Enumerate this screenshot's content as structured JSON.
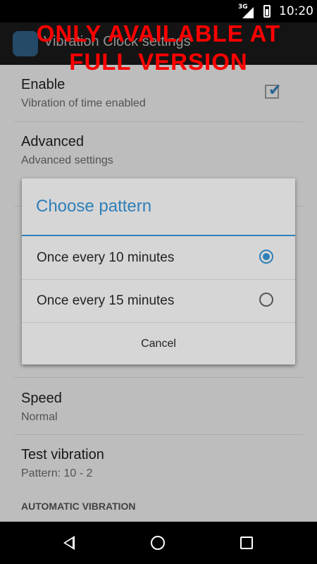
{
  "status_bar": {
    "network": "3G",
    "time": "10:20"
  },
  "action_bar": {
    "title": "Vibration Clock settings"
  },
  "promo_banner": {
    "line1": "ONLY AVAILABLE AT",
    "line2": "FULL VERSION"
  },
  "settings": {
    "enable": {
      "title": "Enable",
      "summary": "Vibration of time enabled",
      "checked": true
    },
    "advanced": {
      "title": "Advanced",
      "summary": "Advanced settings"
    },
    "speed": {
      "title": "Speed",
      "summary": "Normal"
    },
    "test_vibration": {
      "title": "Test vibration",
      "summary": "Pattern: 10 - 2"
    },
    "section_header": "AUTOMATIC VIBRATION"
  },
  "dialog": {
    "title": "Choose pattern",
    "options": [
      {
        "label": "Once every 10 minutes",
        "selected": true
      },
      {
        "label": "Once every 15 minutes",
        "selected": false
      }
    ],
    "cancel_label": "Cancel"
  },
  "colors": {
    "accent": "#2f7fb8",
    "promo": "#ff0000"
  }
}
